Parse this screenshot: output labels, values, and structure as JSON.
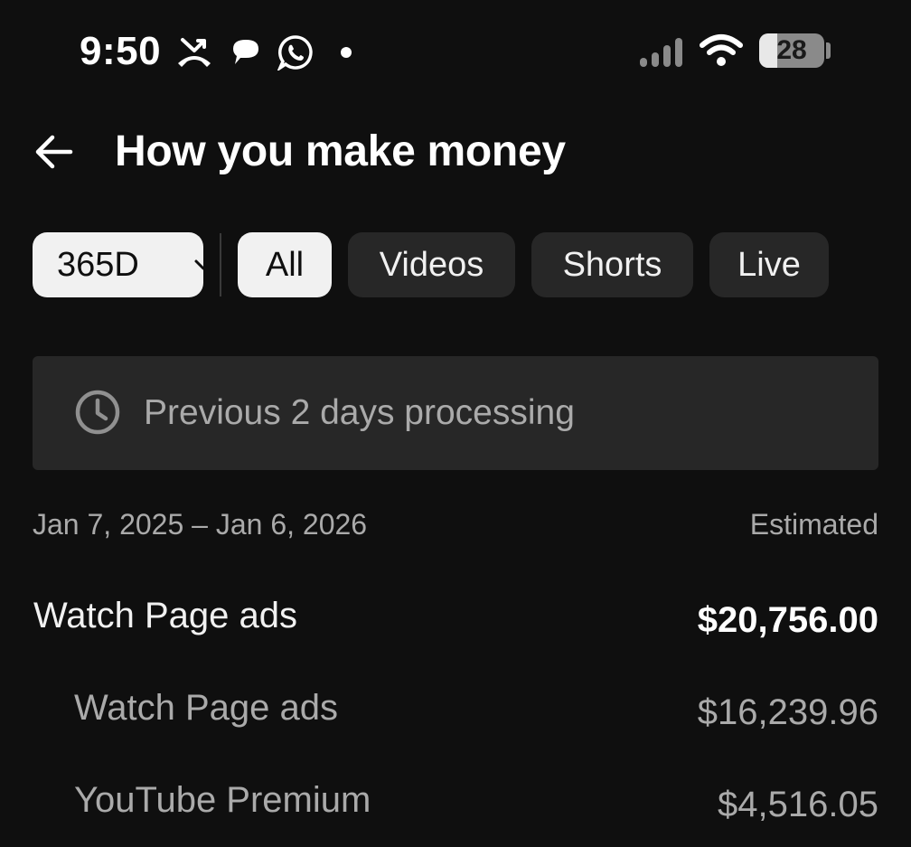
{
  "status_bar": {
    "time": "9:50",
    "battery_level": "28",
    "battery_fraction": 0.28,
    "icons": [
      "missed-call-icon",
      "chat-bubble-icon",
      "whatsapp-icon",
      "notification-dot-icon",
      "signal-icon",
      "wifi-icon",
      "battery-icon"
    ]
  },
  "header": {
    "back_icon": "arrow-left-icon",
    "title": "How you make money"
  },
  "filters": {
    "range_label": "365D",
    "range_icon": "chevron-down-icon",
    "chips": [
      {
        "label": "All",
        "selected": true
      },
      {
        "label": "Videos",
        "selected": false
      },
      {
        "label": "Shorts",
        "selected": false
      },
      {
        "label": "Live",
        "selected": false
      }
    ]
  },
  "banner": {
    "icon": "clock-icon",
    "text": "Previous 2 days processing"
  },
  "period": {
    "date_range": "Jan 7, 2025 – Jan 6, 2026",
    "estimated_label": "Estimated"
  },
  "revenue": {
    "total": {
      "label": "Watch Page ads",
      "value": "$20,756.00"
    },
    "breakdown": [
      {
        "label": "Watch Page ads",
        "value": "$16,239.96"
      },
      {
        "label": "YouTube Premium",
        "value": "$4,516.05"
      }
    ]
  },
  "colors": {
    "background": "#0f0f0f",
    "chip_bg": "#272727",
    "chip_selected_bg": "#f1f1f1",
    "secondary_text": "#aaaaaa"
  }
}
